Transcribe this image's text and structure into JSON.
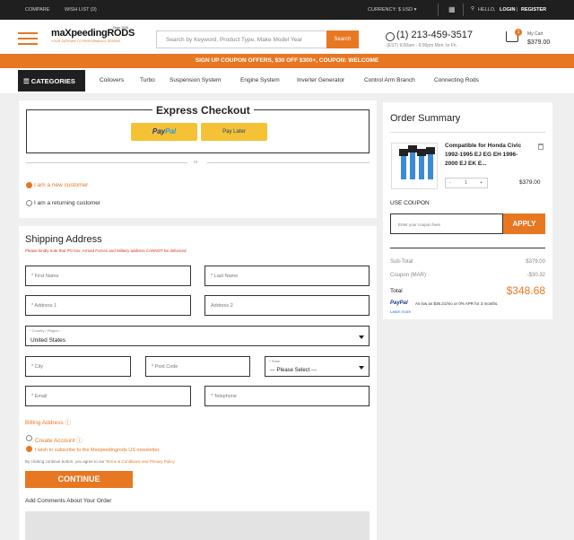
{
  "topbar": {
    "compare": "COMPARE",
    "wishlist": "WISH LIST (0)",
    "currency": "CURRENCY: $ USD ▾",
    "hello": "HELLO,",
    "login": "LOGIN",
    "divider": "|",
    "register": "REGISTER"
  },
  "header": {
    "logo_main": "maXpeedingRODS",
    "logo_since": "Since 2008",
    "logo_tagline": "YOUR GATEWAY TO PERFORMANCE DRIVING",
    "search_placeholder": "Search by Keyword, Product Type, Make Model Year",
    "search_button": "Search",
    "phone": "(1) 213-459-3517",
    "hours": "(EST) 9:00am - 6:00pm Mon. to Fri.",
    "cart_count": "1",
    "cart_label": "My Cart",
    "cart_total": "$379.00"
  },
  "promo": {
    "text": "SIGN UP COUPON OFFERS, $30 OFF $300+, COUPON: WELCOME"
  },
  "nav": {
    "categories": "☰ CATEGORIES",
    "items": [
      "Coilovers",
      "Turbo",
      "Suspension System",
      "Engine System",
      "Inverter Generator",
      "Control Arm Branch",
      "Connecting Rods"
    ]
  },
  "express": {
    "title": "Express Checkout",
    "paypal_a": "Pay",
    "paypal_b": "Pal",
    "paylater": "Pay Later",
    "or": "or",
    "new_customer": "I am a new customer",
    "returning_customer": "I am a returning customer"
  },
  "shipping": {
    "title": "Shipping Address",
    "note": "Please kindly note that PO box, Armed Forces and Military address CANNOT be delivered",
    "first_name": "* First Name",
    "last_name": "* Last Name",
    "address1": "* Address 1",
    "address2": "Address 2",
    "country_label": "* Country / Region",
    "country_value": "United States",
    "city": "* City",
    "postcode": "* Post Code",
    "state_label": "* State",
    "state_value": "--- Please Select ---",
    "email": "* Email",
    "telephone": "* Telephone",
    "billing": "Billing Address ⓘ",
    "create_account": "Create Account ⓘ",
    "subscribe": "I wish to subscribe to the Maxpeedingrods US newsletter.",
    "terms_prefix": "By clicking continue button, you agree to our",
    "terms_link": "Terms & Conditions and Privacy Policy",
    "continue": "CONTINUE",
    "comments_label": "Add Comments About Your Order"
  },
  "summary": {
    "title": "Order Summary",
    "product_name": "Compatible for Honda Civic 1992-1995 EJ EG EH 1996-2000 EJ EK E...",
    "qty_minus": "-",
    "qty_value": "1",
    "qty_plus": "+",
    "product_price": "$379.00",
    "coupon_label": "USE COUPON",
    "coupon_placeholder": "Enter your coupon here",
    "apply": "APPLY",
    "subtotal_label": "Sub-Total",
    "subtotal_value": "$379.00",
    "coupon_row_label": "Coupon (MAR)",
    "coupon_row_value": "-$30.32",
    "total_label": "Total",
    "total_value": "$348.68",
    "paypal_logo": "PayPal",
    "paypal_text": "As low as $36.21/mo or 0% APR for 3 months.",
    "learn_more": "Learn more"
  }
}
